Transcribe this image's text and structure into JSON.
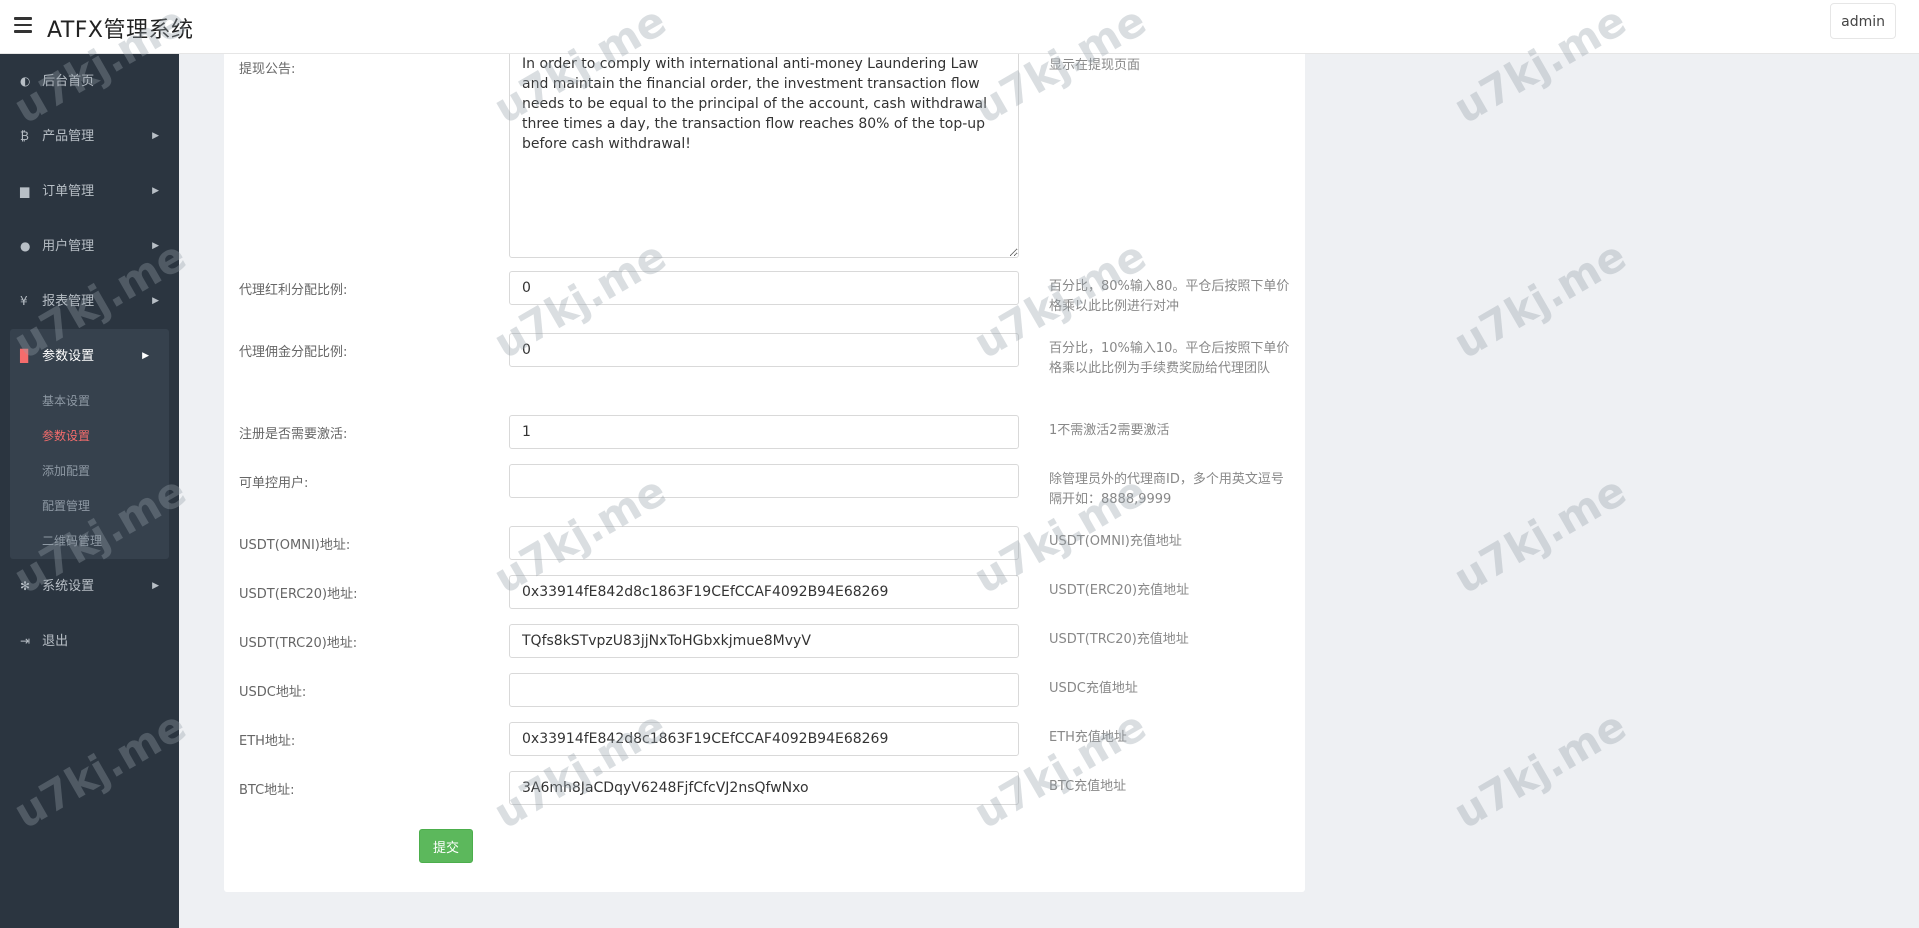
{
  "header": {
    "app_title": "ATFX管理系统",
    "user": "admin"
  },
  "sidebar": {
    "items": [
      {
        "label": "后台首页",
        "icon": "dashboard-icon"
      },
      {
        "label": "产品管理",
        "icon": "bitcoin-icon"
      },
      {
        "label": "订单管理",
        "icon": "orders-icon"
      },
      {
        "label": "用户管理",
        "icon": "user-icon"
      },
      {
        "label": "报表管理",
        "icon": "yen-icon"
      }
    ],
    "active_group": {
      "label": "参数设置",
      "icon": "copy-icon",
      "children": [
        "基本设置",
        "参数设置",
        "添加配置",
        "配置管理",
        "二维码管理"
      ]
    },
    "bottom_items": [
      {
        "label": "系统设置",
        "icon": "cogs-icon"
      },
      {
        "label": "退出",
        "icon": "sign-out-icon"
      }
    ]
  },
  "form": {
    "notice": {
      "label": "提现公告:",
      "value": "In order to comply with international anti-money Laundering Law and maintain the financial order, the investment transaction flow needs to be equal to the principal of the account, cash withdrawal three times a day, the transaction flow reaches 80% of the top-up before cash withdrawal!",
      "hint": "显示在提现页面"
    },
    "fields": [
      {
        "key": "agent_dividend",
        "label": "代理红利分配比例:",
        "value": "0",
        "hint": "百分比，80%输入80。平仓后按照下单价格乘以此比例进行对冲"
      },
      {
        "key": "agent_commission",
        "label": "代理佣金分配比例:",
        "value": "0",
        "hint": "百分比，10%输入10。平仓后按照下单价格乘以此比例为手续费奖励给代理团队"
      },
      {
        "key": "register_activate",
        "label": "注册是否需要激活:",
        "value": "1",
        "hint": "1不需激活2需要激活"
      },
      {
        "key": "controllable_users",
        "label": "可单控用户:",
        "value": "",
        "hint": "除管理员外的代理商ID，多个用英文逗号隔开如：8888,9999"
      },
      {
        "key": "usdt_omni",
        "label": "USDT(OMNI)地址:",
        "value": "",
        "hint": "USDT(OMNI)充值地址"
      },
      {
        "key": "usdt_erc20",
        "label": "USDT(ERC20)地址:",
        "value": "0x33914fE842d8c1863F19CEfCCAF4092B94E68269",
        "hint": "USDT(ERC20)充值地址"
      },
      {
        "key": "usdt_trc20",
        "label": "USDT(TRC20)地址:",
        "value": "TQfs8kSTvpzU83jjNxToHGbxkjmue8MvyV",
        "hint": "USDT(TRC20)充值地址"
      },
      {
        "key": "usdc",
        "label": "USDC地址:",
        "value": "",
        "hint": "USDC充值地址"
      },
      {
        "key": "eth",
        "label": "ETH地址:",
        "value": "0x33914fE842d8c1863F19CEfCCAF4092B94E68269",
        "hint": "ETH充值地址"
      },
      {
        "key": "btc",
        "label": "BTC地址:",
        "value": "3A6mh8JaCDqyV6248FjfCfcVJ2nsQfwNxo",
        "hint": "BTC充值地址"
      }
    ],
    "submit_label": "提交"
  },
  "watermark": "u7kj.me"
}
